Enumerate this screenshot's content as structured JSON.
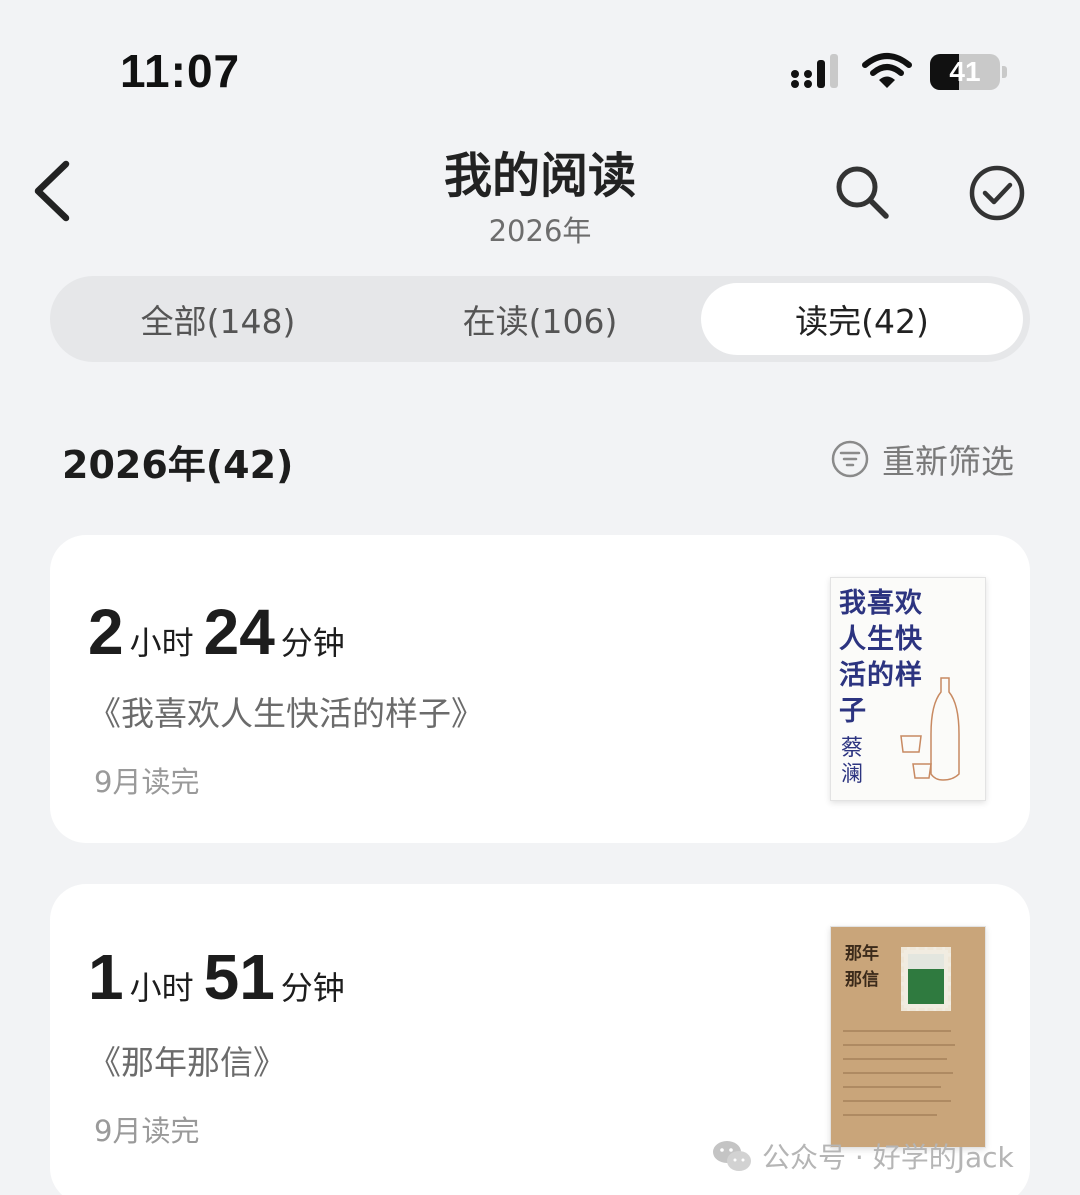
{
  "status_bar": {
    "time": "11:07",
    "battery_level": "41",
    "battery_fraction": 0.41
  },
  "header": {
    "back_icon": "chevron-left-icon",
    "title": "我的阅读",
    "subtitle": "2026年",
    "search_icon": "search-icon",
    "check_icon": "check-circle-icon"
  },
  "tabs": [
    {
      "label": "全部(148)",
      "active": false
    },
    {
      "label": "在读(106)",
      "active": false
    },
    {
      "label": "读完(42)",
      "active": true
    }
  ],
  "section": {
    "title": "2026年(42)",
    "filter_label": "重新筛选",
    "filter_icon": "filter-icon"
  },
  "books": [
    {
      "hours": "2",
      "hours_unit": "小时",
      "minutes": "24",
      "minutes_unit": "分钟",
      "title": "《我喜欢人生快活的样子》",
      "finished": "9月读完",
      "cover_title": "我喜欢人生快活的样子",
      "cover_author": "蔡澜"
    },
    {
      "hours": "1",
      "hours_unit": "小时",
      "minutes": "51",
      "minutes_unit": "分钟",
      "title": "《那年那信》",
      "finished": "9月读完",
      "cover_title": "那年那信"
    }
  ],
  "watermark": {
    "text": "公众号 · 好学的Jack",
    "icon": "wechat-icon"
  },
  "colors": {
    "background": "#f2f3f5",
    "card": "#ffffff",
    "cover_ink": "#2c3480"
  }
}
